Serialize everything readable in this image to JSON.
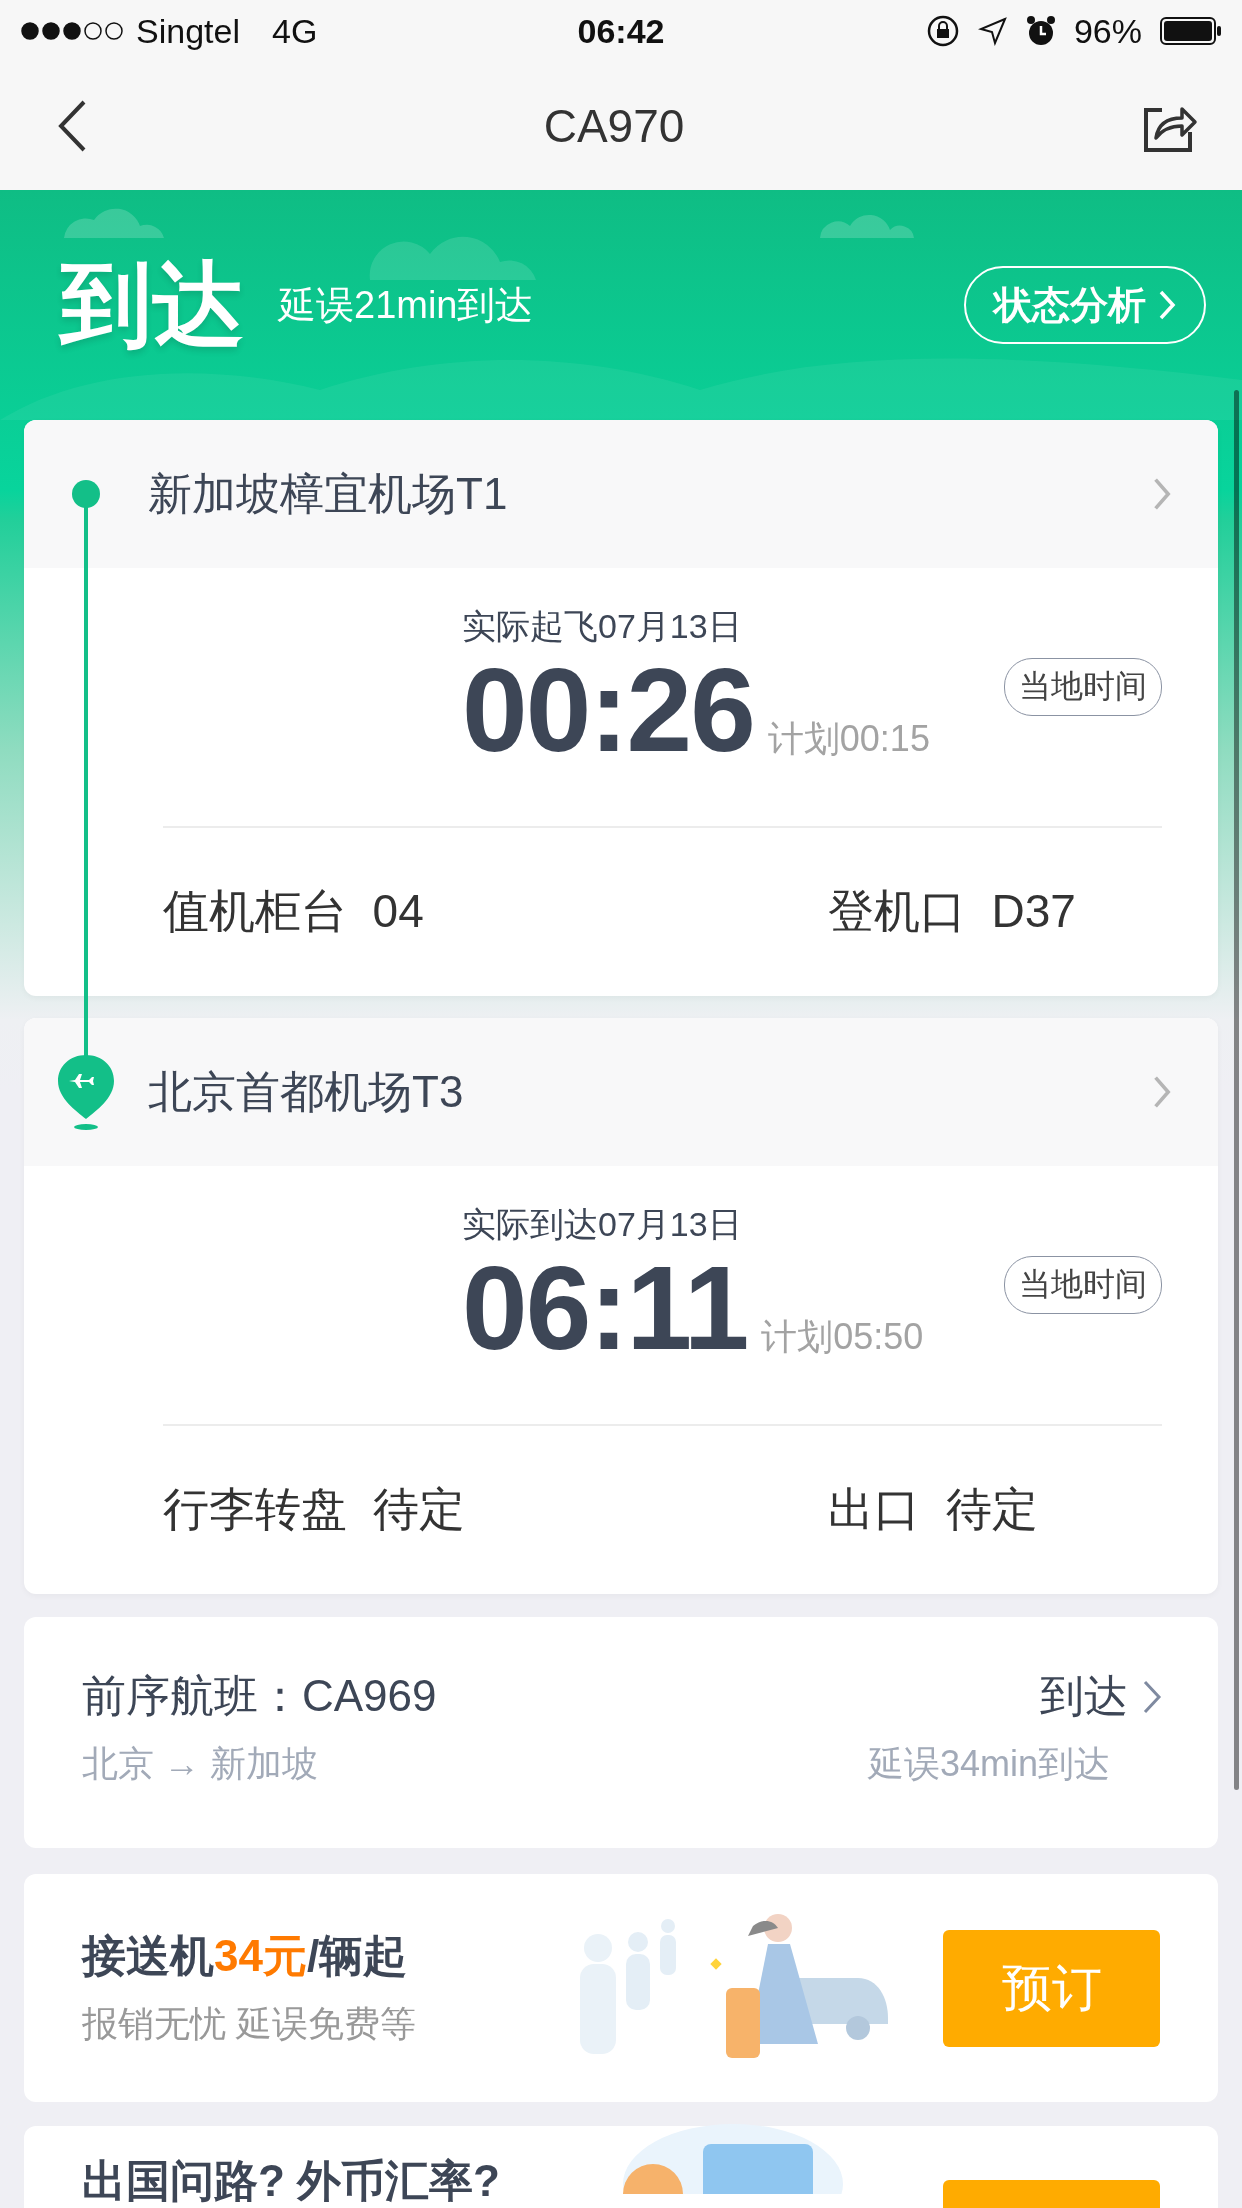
{
  "status_bar": {
    "carrier": "Singtel",
    "network": "4G",
    "time": "06:42",
    "battery": "96%"
  },
  "nav": {
    "title": "CA970"
  },
  "banner": {
    "status": "到达",
    "detail": "延误21min到达",
    "analysis_button": "状态分析"
  },
  "segments": [
    {
      "kind": "departure",
      "airport": "新加坡樟宜机场T1",
      "actual_label": "实际起飞07月13日",
      "actual_time": "00:26",
      "planned": "计划00:15",
      "timezone_tag": "当地时间",
      "facts": [
        {
          "label": "值机柜台",
          "value": "04"
        },
        {
          "label": "登机口",
          "value": "D37"
        }
      ]
    },
    {
      "kind": "arrival",
      "airport": "北京首都机场T3",
      "actual_label": "实际到达07月13日",
      "actual_time": "06:11",
      "planned": "计划05:50",
      "timezone_tag": "当地时间",
      "facts": [
        {
          "label": "行李转盘",
          "value": "待定"
        },
        {
          "label": "出口",
          "value": "待定"
        }
      ]
    }
  ],
  "previous_flight": {
    "label": "前序航班：CA969",
    "route": "北京 → 新加坡",
    "status": "到达",
    "detail": "延误34min到达"
  },
  "promos": [
    {
      "kind": "pickup",
      "title_prefix": "接送机",
      "price": "34元",
      "title_suffix": "/辆起",
      "subtitle": "报销无忧 延误免费等",
      "button": "预订"
    },
    {
      "kind": "currency",
      "title_prefix": "出国问路? 外币汇率?"
    }
  ]
}
